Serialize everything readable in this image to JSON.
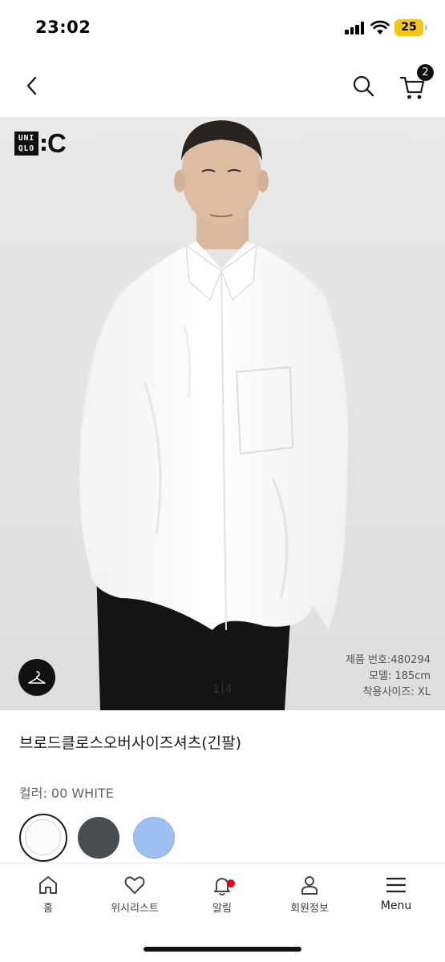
{
  "status_bar": {
    "time": "23:02",
    "battery": "25",
    "icons": [
      "signal-icon",
      "wifi-icon",
      "battery-icon"
    ]
  },
  "nav": {
    "cart_count": "2",
    "icons": [
      "chevron-left-icon",
      "search-icon",
      "cart-icon"
    ]
  },
  "product_image": {
    "logo_box": "UNIQLO",
    "logo_suffix": ":C",
    "page_current": "1",
    "page_total": "4",
    "product_number": "제품 번호:480294",
    "model_height": "모델: 185cm",
    "model_size": "착용사이즈: XL"
  },
  "product": {
    "title": "브로드클로스오버사이즈셔츠(긴팔)",
    "color_label": "컬러: 00 WHITE",
    "swatches": [
      {
        "name": "white",
        "color": "#fbfbfb",
        "selected": true
      },
      {
        "name": "dark-gray",
        "color": "#4b4e51",
        "selected": false
      },
      {
        "name": "light-blue",
        "color": "#9dbff2",
        "selected": false
      }
    ]
  },
  "tab_bar": {
    "tabs": [
      {
        "label": "홈",
        "icon": "home-icon"
      },
      {
        "label": "위시리스트",
        "icon": "heart-icon"
      },
      {
        "label": "알림",
        "icon": "bell-icon"
      },
      {
        "label": "회원정보",
        "icon": "user-icon"
      },
      {
        "label": "Menu",
        "icon": "menu-icon"
      }
    ]
  },
  "colors": {
    "accent_dark": "#111111",
    "notification": "#e4001b",
    "battery": "#f5c518",
    "image_bg": "#ececec"
  }
}
